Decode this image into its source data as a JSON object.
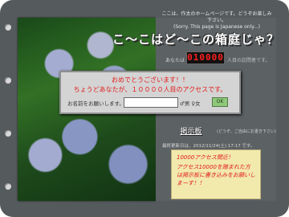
{
  "colors": {
    "frame": "#555a5c",
    "counter_digits": "#ff2020",
    "dialog_text": "#e21b1b",
    "ok_button": "#8fc87a",
    "notice_bg": "#f2e9ad"
  },
  "header": {
    "intro_line1": "ここは、作太のホームページです。どうぞお楽しみ下さい。",
    "intro_line2": "(Sorry. This page is Japanese only...)",
    "site_title": "こ〜こはど〜この箱庭じゃ？"
  },
  "counter": {
    "label": "あなたは",
    "value": "010000",
    "suffix": "人目の訪問者です。"
  },
  "dialog": {
    "line1": "おめでとうございます！！",
    "line2": "ちょうどあなたが、１００００人目のアクセスです。",
    "name_label": "お名前をお願いします。",
    "name_value": "",
    "gender_label": "♂男 ♀女",
    "ok_label": "OK"
  },
  "bbs": {
    "link_label": "掲示板",
    "note": "(どうぞ、ご自由にお書き下さい)"
  },
  "updated": "最終更新日は、2012/11/24(土) 17:17 です。",
  "notice": {
    "title": "10000アクセス間近！",
    "body": "アクセス10000を踏まれた方は掲示板に書き込みをお願いしまーす！！"
  }
}
